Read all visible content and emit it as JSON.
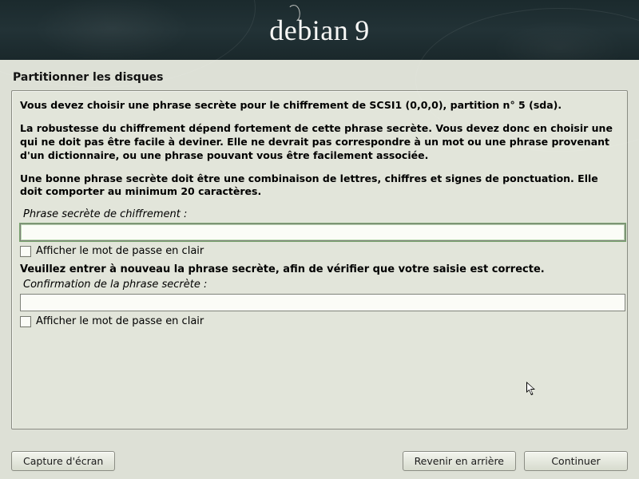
{
  "brand": {
    "name": "debian",
    "version": "9"
  },
  "title": "Partitionner les disques",
  "para1": "Vous devez choisir une phrase secrète pour le chiffrement de SCSI1 (0,0,0), partition n° 5 (sda).",
  "para2": "La robustesse du chiffrement dépend fortement de cette phrase secrète. Vous devez donc en choisir une qui ne doit pas être facile à deviner. Elle ne devrait pas correspondre à un mot ou une phrase provenant d'un dictionnaire, ou une phrase pouvant vous être facilement associée.",
  "para3": "Une bonne phrase secrète doit être une combinaison de lettres, chiffres et signes de ponctuation. Elle doit comporter au minimum 20 caractères.",
  "label1": "Phrase secrète de chiffrement :",
  "show1": "Afficher le mot de passe en clair",
  "prompt2": "Veuillez entrer à nouveau la phrase secrète, afin de vérifier que votre saisie est correcte.",
  "label2": "Confirmation de la phrase secrète :",
  "show2": "Afficher le mot de passe en clair",
  "pass1_value": "",
  "pass2_value": "",
  "buttons": {
    "screenshot": "Capture d'écran",
    "back": "Revenir en arrière",
    "continue": "Continuer"
  }
}
